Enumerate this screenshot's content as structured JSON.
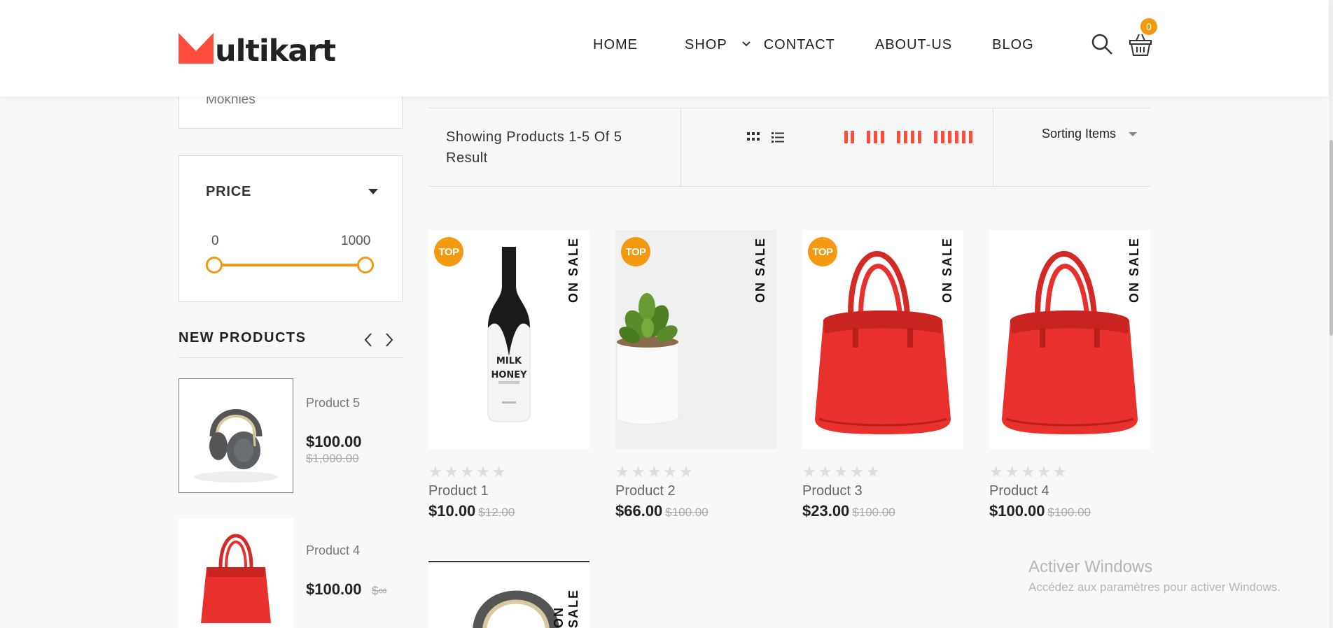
{
  "header": {
    "logo_text": "ultikart",
    "nav": [
      {
        "label": "HOME"
      },
      {
        "label": "SHOP"
      },
      {
        "label": "CONTACT"
      },
      {
        "label": "ABOUT-US"
      },
      {
        "label": "BLOG"
      }
    ],
    "cart_count": "0"
  },
  "sidebar": {
    "previous_filter_item": "Mokhles",
    "price": {
      "title": "PRICE",
      "min": "0",
      "max": "1000"
    },
    "new_products": {
      "title": "NEW PRODUCTS",
      "items": [
        {
          "name": "Product 5",
          "price": "$100.00",
          "old_price": "$1,000.00",
          "image": "headphones"
        },
        {
          "name": "Product 4",
          "price": "$100.00",
          "old_price": "$∞",
          "image": "red-handbag"
        }
      ]
    }
  },
  "toolbar": {
    "showing": "Showing Products 1-5 Of 5 Result",
    "sorting": "Sorting Items"
  },
  "products": [
    {
      "name": "Product 1",
      "price": "$10.00",
      "old_price": "$12.00",
      "badge": "TOP",
      "sale": "ON SALE",
      "image": "milk-honey-bottle",
      "bottle_label_line1": "MILK",
      "bottle_label_line2": "HONEY"
    },
    {
      "name": "Product 2",
      "price": "$66.00",
      "old_price": "$100.00",
      "badge": "TOP",
      "sale": "ON SALE",
      "image": "succulent-plant"
    },
    {
      "name": "Product 3",
      "price": "$23.00",
      "old_price": "$100.00",
      "badge": "TOP",
      "sale": "ON SALE",
      "image": "red-handbag"
    },
    {
      "name": "Product 4",
      "price": "$100.00",
      "old_price": "$100.00",
      "badge": "",
      "sale": "ON SALE",
      "image": "red-handbag"
    },
    {
      "sale": "ON SALE",
      "image": "headphones"
    }
  ],
  "watermark": {
    "line1": "Activer Windows",
    "line2": "Accédez aux paramètres pour activer Windows."
  },
  "colors": {
    "accent_orange": "#f39910",
    "brand_red": "#ff4c3b",
    "handbag_red": "#e8302c"
  }
}
